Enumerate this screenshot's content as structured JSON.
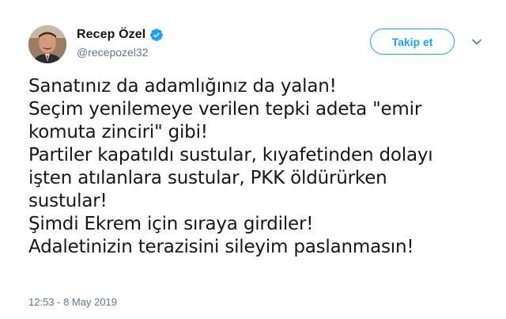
{
  "author": {
    "display_name": "Recep Özel",
    "handle": "@recepozel32",
    "verified": true,
    "avatar_icon": "profile-photo"
  },
  "follow_button": {
    "label": "Takip et"
  },
  "menu": {
    "icon": "chevron-down-icon"
  },
  "tweet": {
    "lines": [
      "Sanatınız da adamlığınız da yalan!",
      "Seçim yenilemeye verilen tepki adeta \"emir",
      "komuta zinciri\" gibi!",
      "Partiler kapatıldı sustular, kıyafetinden dolayı",
      "işten atılanlara sustular, PKK öldürürken",
      "sustular!",
      "Şimdi Ekrem için sıraya girdiler!",
      "Adaletinizin terazisini sileyim paslanmasın!"
    ],
    "timestamp": "12:53 - 8 May 2019"
  },
  "colors": {
    "accent": "#1da1f2",
    "text": "#14171a",
    "muted": "#657786"
  }
}
